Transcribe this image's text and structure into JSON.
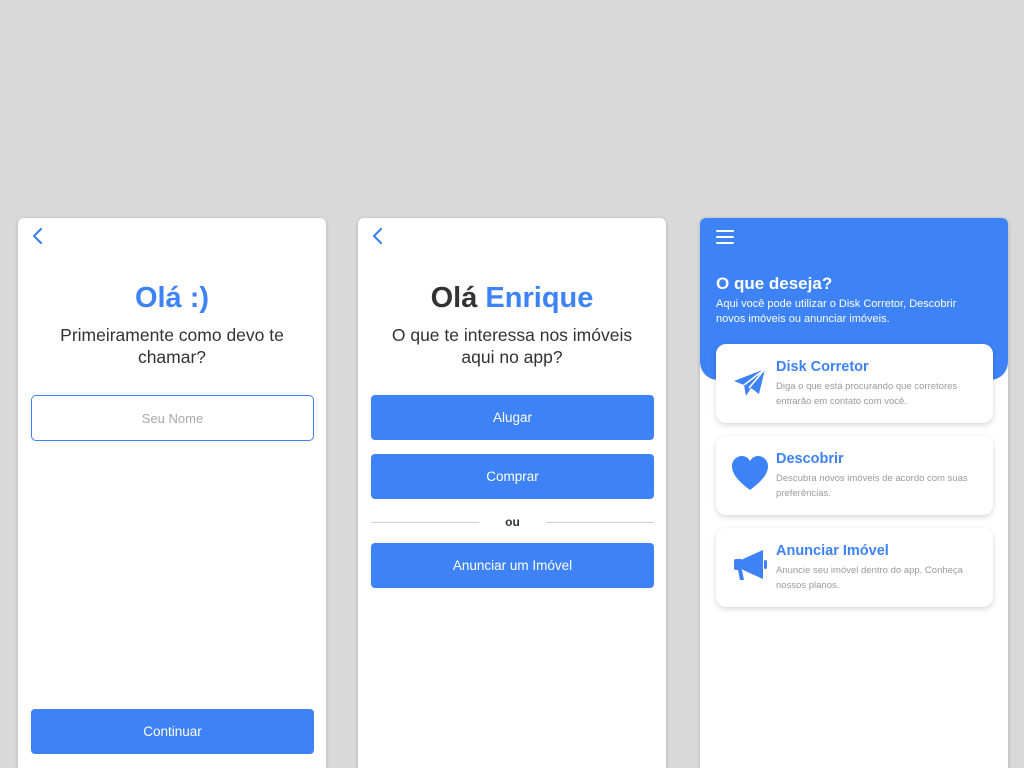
{
  "colors": {
    "accent": "#3d82f6",
    "background": "#d9d9d9",
    "text": "#333333"
  },
  "screen1": {
    "back_icon": "chevron-left-icon",
    "title": "Olá :)",
    "subtitle": "Primeiramente como devo te chamar?",
    "name_input": {
      "placeholder": "Seu Nome",
      "value": ""
    },
    "continue_label": "Continuar"
  },
  "screen2": {
    "back_icon": "chevron-left-icon",
    "title_greeting": "Olá",
    "title_name": "Enrique",
    "subtitle": "O que te interessa nos imóveis aqui no app?",
    "rent_label": "Alugar",
    "buy_label": "Comprar",
    "divider_label": "ou",
    "advertise_label": "Anunciar um Imóvel"
  },
  "screen3": {
    "menu_icon": "hamburger-menu-icon",
    "title": "O que deseja?",
    "description": "Aqui você pode utilizar o Disk Corretor, Descobrir novos imóveis ou anunciar imóveis.",
    "cards": [
      {
        "icon": "paper-plane-icon",
        "title": "Disk Corretor",
        "description": "Diga o que está procurando que corretores entrarão em contato com você."
      },
      {
        "icon": "heart-icon",
        "title": "Descobrir",
        "description": "Descubra novos imóveis de acordo com suas preferências."
      },
      {
        "icon": "megaphone-icon",
        "title": "Anunciar Imóvel",
        "description": "Anuncie seu imóvel dentro do app. Conheça nossos planos."
      }
    ]
  }
}
